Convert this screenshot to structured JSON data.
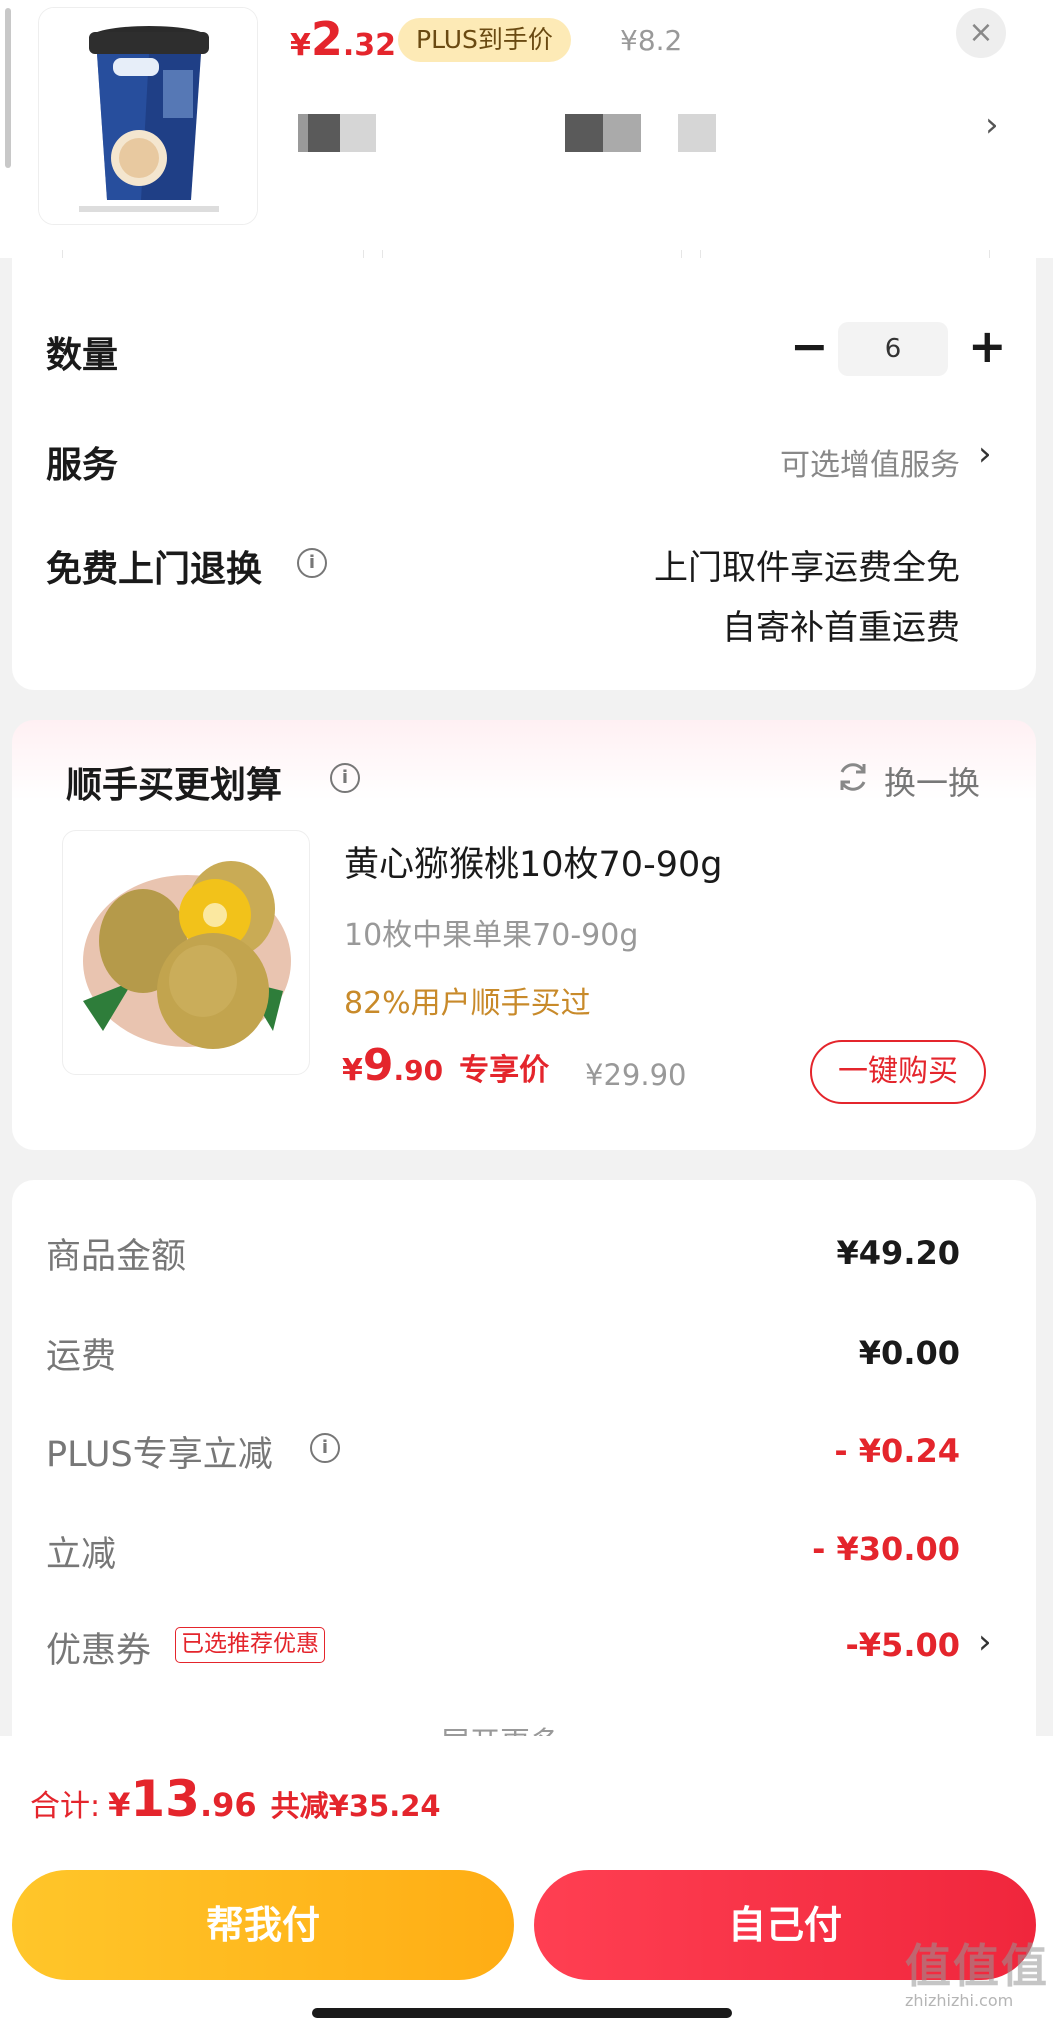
{
  "header": {
    "price_yen": "¥",
    "price_int": "2",
    "price_dec": ".32",
    "plus_badge": "PLUS到手价",
    "orig_price": "¥8.2",
    "close_icon": "×",
    "chevron": "›"
  },
  "quantity": {
    "label": "数量",
    "minus": "−",
    "value": "6",
    "plus": "+"
  },
  "service": {
    "label": "服务",
    "link": "可选增值服务",
    "chevron": "›"
  },
  "returns": {
    "label": "免费上门退换",
    "info": "i",
    "line1": "上门取件享运费全免",
    "line2": "自寄补首重运费"
  },
  "addon": {
    "title": "顺手买更划算",
    "info": "i",
    "refresh": "换一换",
    "name": "黄心猕猴桃10枚70-90g",
    "spec": "10枚中果单果70-90g",
    "bought_pct": "82%用户顺手买过",
    "price_yen": "¥",
    "price_int": "9",
    "price_dec": ".90",
    "price_label": "专享价",
    "orig_price": "¥29.90",
    "buy_button": "一键购买"
  },
  "fees": {
    "goods_label": "商品金额",
    "goods_value": "¥49.20",
    "shipping_label": "运费",
    "shipping_value": "¥0.00",
    "plus_label": "PLUS专享立减",
    "plus_info": "i",
    "plus_value": "- ¥0.24",
    "discount_label": "立减",
    "discount_value": "- ¥30.00",
    "coupon_label": "优惠券",
    "coupon_badge": "已选推荐优惠",
    "coupon_value": "-¥5.00",
    "coupon_chevron": "›",
    "expand": "展开更多 ⌄"
  },
  "footer": {
    "total_label": "合计:",
    "total_yen": "¥",
    "total_int": "13",
    "total_dec": ".96",
    "saved": "共减¥35.24",
    "pay_friend": "帮我付",
    "pay_self": "自己付"
  },
  "watermark": {
    "main": "值值值",
    "sub": "zhizhizhi.com"
  },
  "colors": {
    "accent_red": "#e4252c",
    "gold": "#ffb81c",
    "orange_text": "#c88a2a"
  }
}
